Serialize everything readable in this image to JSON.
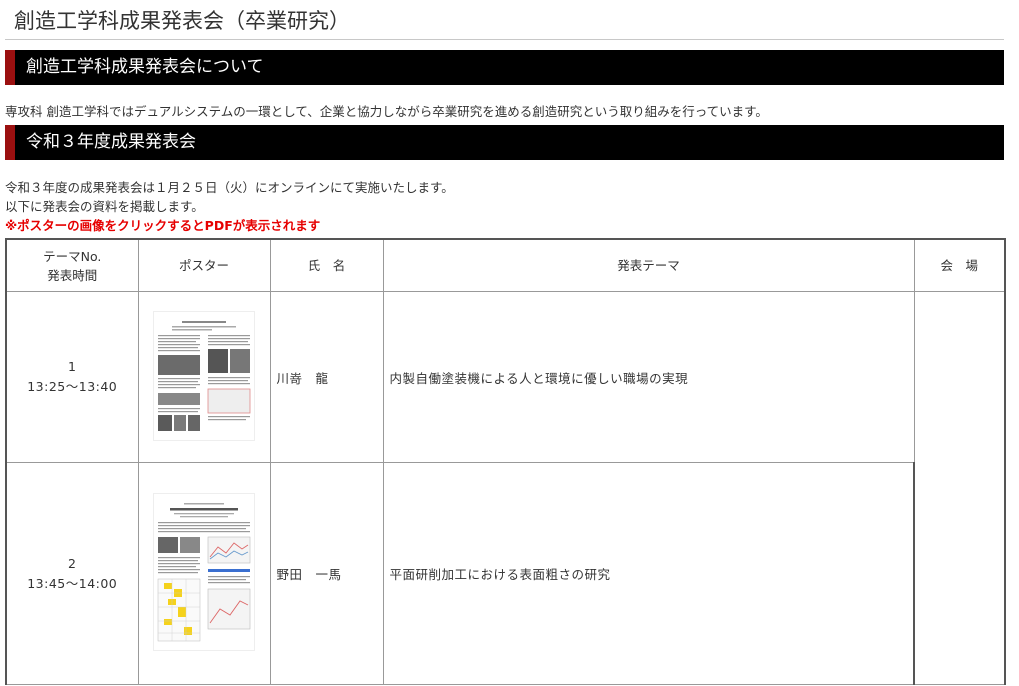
{
  "page": {
    "title": "創造工学科成果発表会（卒業研究）"
  },
  "about": {
    "heading": "創造工学科成果発表会について",
    "body": "専攻科 創造工学科ではデュアルシステムの一環として、企業と協力しながら卒業研究を進める創造研究という取り組みを行っています。"
  },
  "r3": {
    "heading": "令和３年度成果発表会",
    "line1": "令和３年度の成果発表会は１月２５日（火）にオンラインにて実施いたします。",
    "line2": "以下に発表会の資料を掲載します。",
    "notice": "※ポスターの画像をクリックするとPDFが表示されます"
  },
  "table": {
    "headers": {
      "no_line1": "テーマNo.",
      "no_line2": "発表時間",
      "poster": "ポスター",
      "name": "氏　名",
      "theme": "発表テーマ",
      "venue": "会　場"
    },
    "rows": [
      {
        "no": "1",
        "time": "13:25～13:40",
        "name": "川嵜　龍",
        "theme": "内製自働塗装機による人と環境に優しい職場の実現"
      },
      {
        "no": "2",
        "time": "13:45～14:00",
        "name": "野田　一馬",
        "theme": "平面研削加工における表面粗さの研究"
      }
    ]
  },
  "colors": {
    "heading_bg": "#000000",
    "heading_accent": "#9b1010",
    "notice": "#e60000"
  }
}
